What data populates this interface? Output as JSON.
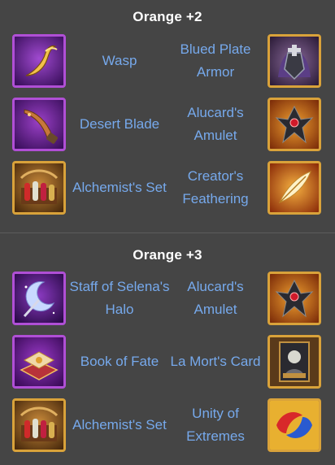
{
  "sections": [
    {
      "title": "Orange +2",
      "rows": [
        {
          "left": {
            "name": "Wasp",
            "frame": "purple",
            "icon": "wasp-icon"
          },
          "right": {
            "name": "Blued Plate Armor",
            "frame": "gold",
            "icon": "blued-plate-armor-icon"
          }
        },
        {
          "left": {
            "name": "Desert Blade",
            "frame": "purple",
            "icon": "desert-blade-icon"
          },
          "right": {
            "name": "Alucard's Amulet",
            "frame": "gold",
            "icon": "alucards-amulet-icon"
          }
        },
        {
          "left": {
            "name": "Alchemist's Set",
            "frame": "gold",
            "icon": "alchemists-set-icon"
          },
          "right": {
            "name": "Creator's Feathering",
            "frame": "gold",
            "icon": "creators-feathering-icon"
          }
        }
      ]
    },
    {
      "title": "Orange +3",
      "rows": [
        {
          "left": {
            "name": "Staff of Selena's Halo",
            "frame": "purple",
            "icon": "staff-of-selenas-halo-icon"
          },
          "right": {
            "name": "Alucard's Amulet",
            "frame": "gold",
            "icon": "alucards-amulet-icon"
          }
        },
        {
          "left": {
            "name": "Book of Fate",
            "frame": "purple",
            "icon": "book-of-fate-icon"
          },
          "right": {
            "name": "La Mort's Card",
            "frame": "gold",
            "icon": "la-morts-card-icon"
          }
        },
        {
          "left": {
            "name": "Alchemist's Set",
            "frame": "gold",
            "icon": "alchemists-set-icon"
          },
          "right": {
            "name": "Unity of Extremes",
            "frame": "gold",
            "icon": "unity-of-extremes-icon"
          }
        }
      ]
    }
  ],
  "colors": {
    "background": "#454545",
    "item_name": "#76a9ec",
    "title": "#ffffff",
    "frame_purple": "#b04fd6",
    "frame_gold": "#d9a23a"
  }
}
